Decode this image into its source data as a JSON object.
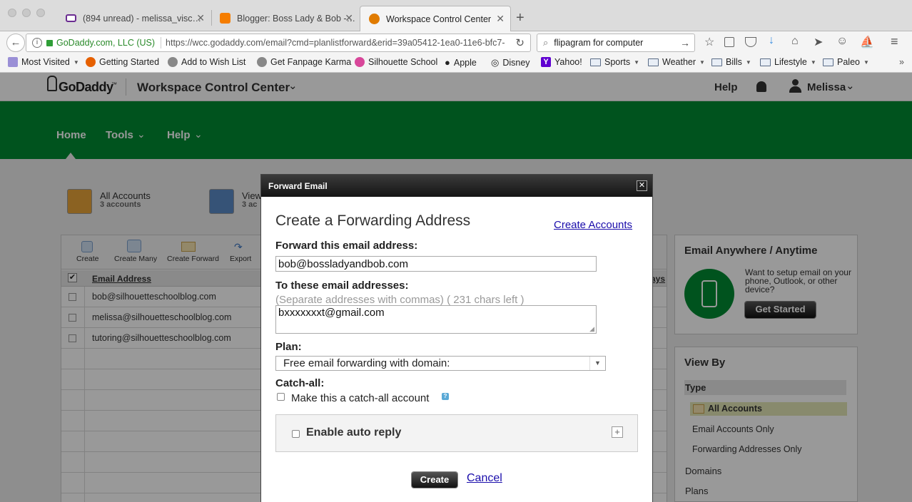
{
  "browser": {
    "tabs": [
      {
        "title": "(894 unread) - melissa_visc…"
      },
      {
        "title": "Blogger: Boss Lady & Bob -…"
      },
      {
        "title": "Workspace Control Center"
      }
    ],
    "identity": "GoDaddy.com, LLC (US)",
    "url": "https://wcc.godaddy.com/email?cmd=planlistforward&erid=39a05412-1ea0-11e6-bfc7-",
    "search_value": "flipagram for computer",
    "bookmarks": [
      {
        "label": "Most Visited",
        "dropdown": true
      },
      {
        "label": "Getting Started"
      },
      {
        "label": "Add to Wish List"
      },
      {
        "label": "Get Fanpage Karma"
      },
      {
        "label": "Silhouette School"
      },
      {
        "label": "Apple"
      },
      {
        "label": "Disney"
      },
      {
        "label": "Yahoo!"
      },
      {
        "label": "Sports",
        "dropdown": true
      },
      {
        "label": "Weather",
        "dropdown": true
      },
      {
        "label": "Bills",
        "dropdown": true
      },
      {
        "label": "Lifestyle",
        "dropdown": true
      },
      {
        "label": "Paleo",
        "dropdown": true
      }
    ]
  },
  "app": {
    "logo": "GoDaddy",
    "logo_tm": "™",
    "title": "Workspace Control Center",
    "help": "Help",
    "user": "Melissa",
    "nav": [
      "Home",
      "Tools",
      "Help"
    ]
  },
  "accounts": {
    "all_label": "All Accounts",
    "all_count": "3 accounts",
    "view_label": "View",
    "view_count": "3 ac",
    "toolbar": [
      "Create",
      "Create Many",
      "Create Forward",
      "Export"
    ],
    "column_header": "Email Address",
    "column_right": "ays",
    "rows": [
      "bob@silhouetteschoolblog.com",
      "melissa@silhouetteschoolblog.com",
      "tutoring@silhouetteschoolblog.com"
    ]
  },
  "sidebar": {
    "promo_title": "Email Anywhere / Anytime",
    "promo_text": "Want to setup email on your phone, Outlook, or other device?",
    "promo_button": "Get Started",
    "viewby_title": "View By",
    "type_label": "Type",
    "type_items": [
      "All Accounts",
      "Email Accounts Only",
      "Forwarding Addresses Only"
    ],
    "groups": [
      "Domains",
      "Plans"
    ]
  },
  "dialog": {
    "title": "Forward Email",
    "heading": "Create a Forwarding Address",
    "create_accounts_link": "Create Accounts",
    "forward_label": "Forward this email address:",
    "forward_value": "bob@bossladyandbob.com",
    "to_label": "To these email addresses:",
    "to_hint": "(Separate addresses with commas) ( 231 chars left )",
    "to_value": "bxxxxxxxt@gmail.com",
    "plan_label": "Plan:",
    "plan_value": "Free email forwarding with domain:",
    "catchall_label": "Catch-all:",
    "catchall_text": "Make this a catch-all account",
    "autoreply_label": "Enable auto reply",
    "create_button": "Create",
    "cancel_link": "Cancel"
  },
  "colors": {
    "brand_green": "#008a32",
    "dialog_header": "#1e1e1e",
    "link_blue": "#1a0dab"
  }
}
